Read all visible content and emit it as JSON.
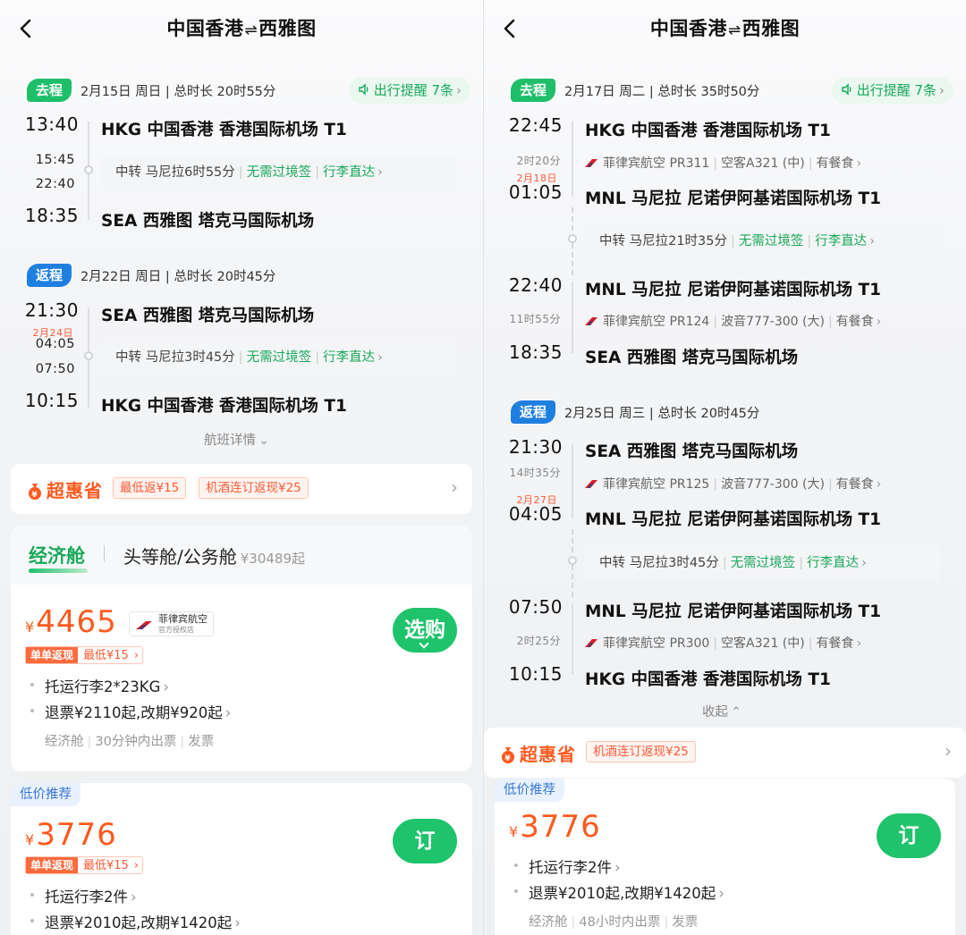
{
  "left": {
    "title": {
      "from": "中国香港",
      "arrows": "⇌",
      "to": "西雅图"
    },
    "outbound": {
      "badge": "去程",
      "summary": "2月15日 周日 | 总时长 20时55分",
      "remind": "出行提醒 7条",
      "dep_time": "13:40",
      "dep_airport": "HKG 中国香港 香港国际机场 T1",
      "transfer_arr": "15:45",
      "transfer_dep": "22:40",
      "transfer_text": "中转 马尼拉6时55分",
      "no_visa": "无需过境签",
      "baggage_direct": "行李直达",
      "arr_time": "18:35",
      "arr_airport": "SEA 西雅图 塔克马国际机场"
    },
    "return": {
      "badge": "返程",
      "summary": "2月22日 周日 | 总时长 20时45分",
      "dep_time": "21:30",
      "dep_airport": "SEA 西雅图 塔克马国际机场",
      "next_day": "2月24日",
      "transfer_arr": "04:05",
      "transfer_dep": "07:50",
      "transfer_text": "中转 马尼拉3时45分",
      "no_visa": "无需过境签",
      "baggage_direct": "行李直达",
      "arr_time": "10:15",
      "arr_airport": "HKG 中国香港 香港国际机场 T1"
    },
    "details_link": "航班详情",
    "promo": {
      "logo": "超惠省",
      "tag1": "最低返¥15",
      "tag2": "机酒连订返现¥25"
    },
    "cabin": {
      "active": "经济舱",
      "other": "头等舱/公务舱",
      "other_price": "¥30489起"
    },
    "offer1": {
      "yen": "¥",
      "price": "4465",
      "airline": "菲律宾航空",
      "airline_sub": "官方授权店",
      "cashback_hot": "单单返现",
      "cashback_min": "最低¥15",
      "baggage": "托运行李2*23KG",
      "refund": "退票¥2110起,改期¥920起",
      "meta": [
        "经济舱",
        "30分钟内出票",
        "发票"
      ],
      "button": "选购"
    },
    "offer2": {
      "tag": "低价推荐",
      "yen": "¥",
      "price": "3776",
      "cashback_hot": "单单返现",
      "cashback_min": "最低¥15",
      "baggage": "托运行李2件",
      "refund": "退票¥2010起,改期¥1420起",
      "button": "订"
    }
  },
  "right": {
    "title": {
      "from": "中国香港",
      "arrows": "⇌",
      "to": "西雅图"
    },
    "outbound": {
      "badge": "去程",
      "summary": "2月17日 周二 | 总时长 35时50分",
      "remind": "出行提醒 7条",
      "seg1_dep_time": "22:45",
      "seg1_dep_airport": "HKG 中国香港 香港国际机场 T1",
      "seg1_duration": "2时20分",
      "seg1_flight": "菲律宾航空 PR311",
      "seg1_plane": "空客A321 (中)",
      "seg1_meal": "有餐食",
      "seg1_next_day": "2月18日",
      "seg1_arr_time": "01:05",
      "seg1_arr_airport": "MNL 马尼拉 尼诺伊阿基诺国际机场 T1",
      "transfer_text": "中转 马尼拉21时35分",
      "no_visa": "无需过境签",
      "baggage_direct": "行李直达",
      "seg2_dep_time": "22:40",
      "seg2_dep_airport": "MNL 马尼拉 尼诺伊阿基诺国际机场 T1",
      "seg2_duration": "11时55分",
      "seg2_flight": "菲律宾航空 PR124",
      "seg2_plane": "波音777-300 (大)",
      "seg2_meal": "有餐食",
      "seg2_arr_time": "18:35",
      "seg2_arr_airport": "SEA 西雅图 塔克马国际机场"
    },
    "return": {
      "badge": "返程",
      "summary": "2月25日 周三 | 总时长 20时45分",
      "seg1_dep_time": "21:30",
      "seg1_dep_airport": "SEA 西雅图 塔克马国际机场",
      "seg1_duration": "14时35分",
      "seg1_flight": "菲律宾航空 PR125",
      "seg1_plane": "波音777-300 (大)",
      "seg1_meal": "有餐食",
      "seg1_next_day": "2月27日",
      "seg1_arr_time": "04:05",
      "seg1_arr_airport": "MNL 马尼拉 尼诺伊阿基诺国际机场 T1",
      "transfer_text": "中转 马尼拉3时45分",
      "no_visa": "无需过境签",
      "baggage_direct": "行李直达",
      "seg2_dep_time": "07:50",
      "seg2_dep_airport": "MNL 马尼拉 尼诺伊阿基诺国际机场 T1",
      "seg2_duration": "2时25分",
      "seg2_flight": "菲律宾航空 PR300",
      "seg2_plane": "空客A321 (中)",
      "seg2_meal": "有餐食",
      "seg2_arr_time": "10:15",
      "seg2_arr_airport": "HKG 中国香港 香港国际机场 T1"
    },
    "collapse_link": "收起",
    "promo": {
      "logo": "超惠省",
      "tag1": "机酒连订返现¥25"
    },
    "offer": {
      "tag": "低价推荐",
      "yen": "¥",
      "price": "3776",
      "baggage": "托运行李2件",
      "refund": "退票¥2010起,改期¥1420起",
      "meta": [
        "经济舱",
        "48小时内出票",
        "发票"
      ],
      "button": "订"
    }
  },
  "colors": {
    "green": "#1fbf6a",
    "blue": "#1f7fe0",
    "orange": "#ff5a1f"
  },
  "icons": [
    "back-arrow-icon",
    "speaker-icon",
    "chevron-right-icon",
    "chevron-down-icon",
    "chevron-up-icon",
    "airline-logo-icon",
    "money-bag-icon"
  ]
}
